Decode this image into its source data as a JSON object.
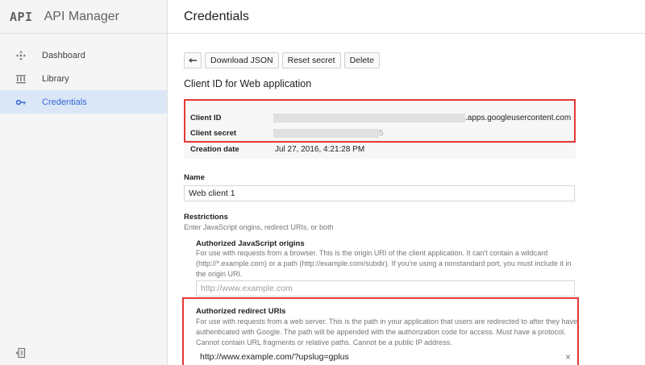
{
  "app": {
    "logo": "API",
    "name": "API Manager"
  },
  "sidebar": {
    "items": [
      {
        "label": "Dashboard",
        "icon": "dashboard-icon"
      },
      {
        "label": "Library",
        "icon": "library-icon"
      },
      {
        "label": "Credentials",
        "icon": "key-icon",
        "active": true
      }
    ],
    "collapse_icon": "collapse-sidebar-icon"
  },
  "header": {
    "title": "Credentials"
  },
  "toolbar": {
    "back_icon": "back-arrow-icon",
    "download_label": "Download JSON",
    "reset_label": "Reset secret",
    "delete_label": "Delete"
  },
  "client": {
    "heading": "Client ID for Web application",
    "client_id_label": "Client ID",
    "client_id_suffix": ".apps.googleusercontent.com",
    "client_secret_label": "Client secret",
    "client_secret_tail": "5",
    "creation_date_label": "Creation date",
    "creation_date_value": "Jul 27, 2016, 4:21:28 PM"
  },
  "form": {
    "name_label": "Name",
    "name_value": "Web client 1",
    "restrictions_label": "Restrictions",
    "restrictions_help": "Enter JavaScript origins, redirect URIs, or both",
    "js_origins_label": "Authorized JavaScript origins",
    "js_origins_help": "For use with requests from a browser. This is the origin URI of the client application. It can't contain a wildcard (http://*.example.com) or a path (http://example.com/subdir). If you're using a nonstandard port, you must include it in the origin URI.",
    "js_origins_placeholder": "http://www.example.com",
    "redirect_label": "Authorized redirect URIs",
    "redirect_help": "For use with requests from a web server. This is the path in your application that users are redirected to after they have authenticated with Google. The path will be appended with the authorization code for access. Must have a protocol. Cannot contain URL fragments or relative paths. Cannot be a public IP address.",
    "redirect_value": "http://www.example.com/?upslug=gplus",
    "clear_icon": "×"
  },
  "colors": {
    "accent": "#3367d6",
    "highlight": "#e53935",
    "sidebar_bg": "#f5f5f5",
    "active_bg": "#dbe6f6"
  }
}
